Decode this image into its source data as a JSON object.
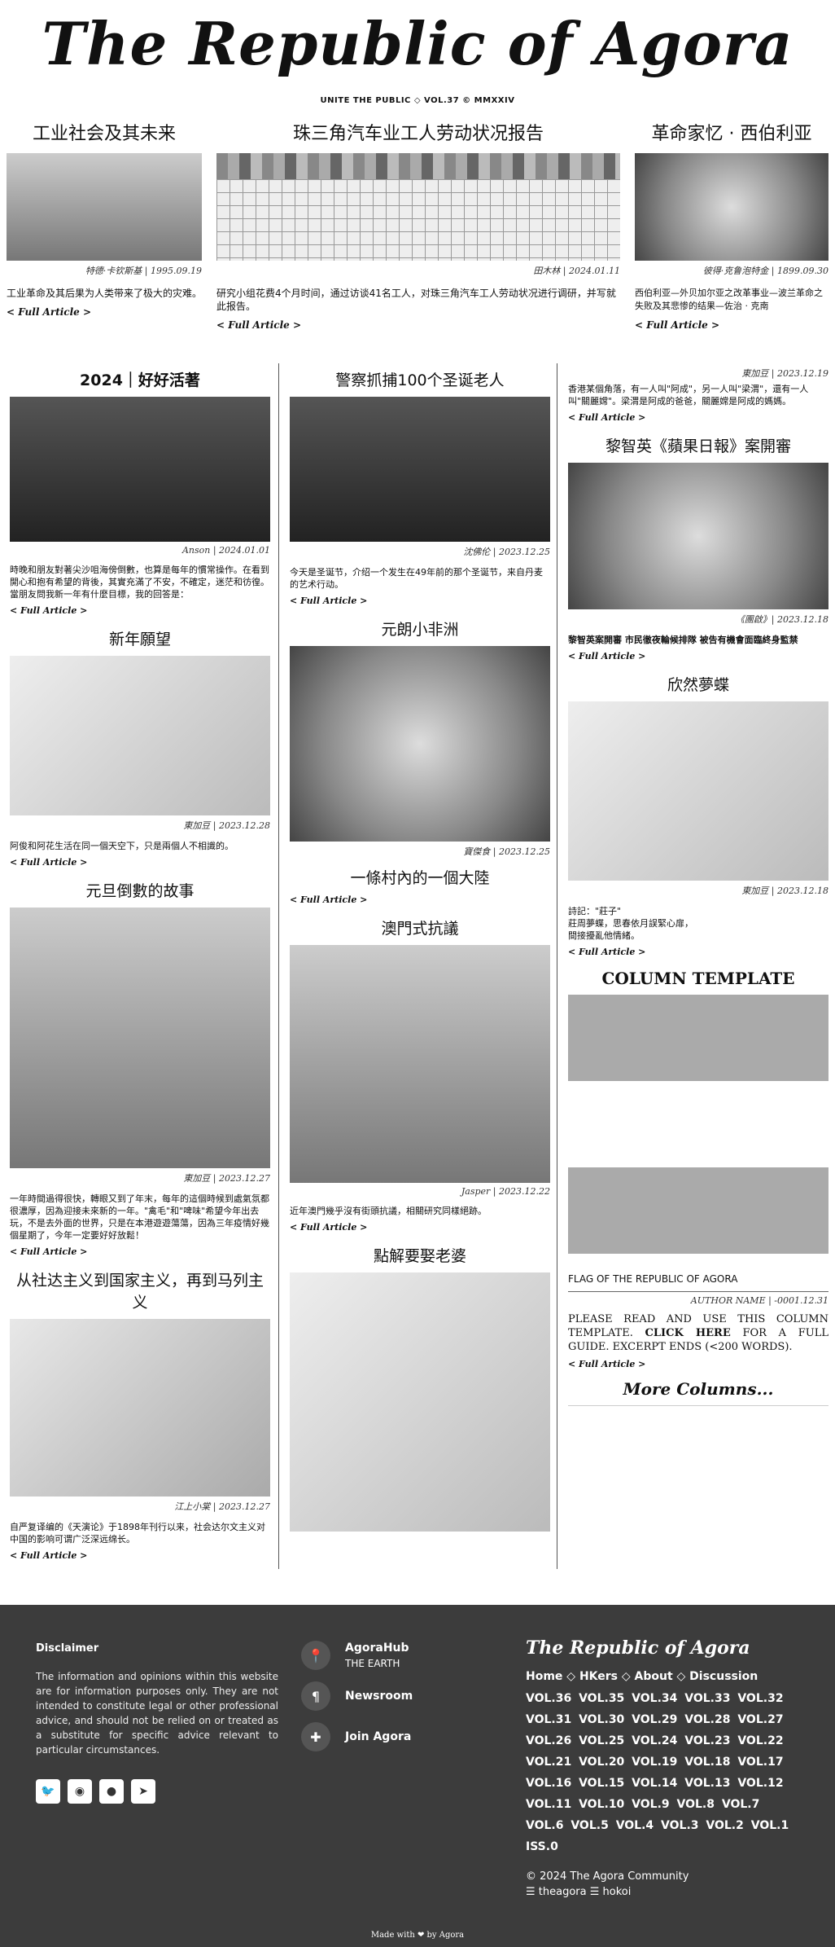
{
  "masthead": {
    "title": "The Republic of Agora",
    "subtitle": "UNITE THE PUBLIC ◇ VOL.37 © MMXXIV"
  },
  "top": [
    {
      "title": "工业社会及其未来",
      "byline": "特德·卡钦斯基 | 1995.09.19",
      "excerpt": "工业革命及其后果为人类带来了极大的灾难。",
      "more": "< Full Article >"
    },
    {
      "title": "珠三角汽车业工人劳动状况报告",
      "byline": "田木林 | 2024.01.11",
      "excerpt": "研究小组花费4个月时间，通过访谈41名工人，对珠三角汽车工人劳动状况进行调研，并写就此报告。",
      "more": "< Full Article >"
    },
    {
      "title": "革命家忆 · 西伯利亚",
      "byline": "彼得·克鲁泡特金 | 1899.09.30",
      "excerpt": "西伯利亚—外贝加尔亚之改革事业—波兰革命之失败及其悲惨的结果—佐治 · 克南",
      "more": "< Full Article >"
    }
  ],
  "col1": [
    {
      "title": "2024｜好好活著",
      "byline": "Anson | 2024.01.01",
      "excerpt": "時晚和朋友對著尖沙咀海傍倒數，也算是每年的慣常操作。在看到開心和抱有希望的背後，其實充滿了不安，不確定，迷茫和彷徨。當朋友問我新一年有什麼目標，我的回答是：",
      "more": "< Full Article >"
    },
    {
      "title": "新年願望",
      "byline": "東加豆 | 2023.12.28",
      "excerpt": "阿俊和阿花生活在同一個天空下，只是兩個人不相識的。",
      "more": "< Full Article >"
    },
    {
      "title": "元旦倒數的故事",
      "byline": "東加豆 | 2023.12.27",
      "excerpt": "一年時間過得很快，轉眼又到了年末，每年的這個時候到處氣氛都很濃厚，因為迎接未來新的一年。\"禽毛\"和\"啤味\"希望今年出去玩，不是去外面的世界，只是在本港遊遊蕩蕩，因為三年疫情好幾個星期了，今年一定要好好放鬆！",
      "more": "< Full Article >"
    },
    {
      "title": "从社达主义到国家主义，再到马列主义",
      "byline": "江上小棠 | 2023.12.27",
      "excerpt": "自严复译编的《天演论》于1898年刊行以来，社会达尔文主义对中国的影响可谓广泛深远绵长。",
      "more": "< Full Article >"
    }
  ],
  "col2": [
    {
      "title": "警察抓捕100个圣诞老人",
      "byline": "沈佛伦 | 2023.12.25",
      "excerpt": "今天是圣诞节，介绍一个发生在49年前的那个圣诞节，来自丹麦的艺术行动。",
      "more": "< Full Article >"
    },
    {
      "title": "元朗小非洲",
      "byline": "寶傑食 | 2023.12.25",
      "subtitle": "一條村內的一個大陸",
      "more": "< Full Article >"
    },
    {
      "title": "澳門式抗議",
      "byline": "Jasper | 2023.12.22",
      "excerpt": "近年澳門幾乎沒有街頭抗議，相關研究同樣絕跡。",
      "more": "< Full Article >"
    },
    {
      "title": "點解要娶老婆"
    }
  ],
  "col3": [
    {
      "byline": "東加豆 | 2023.12.19",
      "excerpt": "香港某個角落，有一人叫\"阿成\"，另一人叫\"梁渭\"，還有一人叫\"關麗嫦\"。梁渭是阿成的爸爸，關麗嫦是阿成的媽媽。",
      "more": "< Full Article >"
    },
    {
      "title": "黎智英《蘋果日報》案開審",
      "byline": "《團啟》| 2023.12.18",
      "excerpt": "黎智英案開審 市民徹夜輪候排隊 被告有機會面臨終身監禁",
      "more": "< Full Article >"
    },
    {
      "title": "欣然夢蝶",
      "byline": "東加豆 | 2023.12.18",
      "excerpt": "詩記：\"莊子\"\n莊周夢蝶，思春依月誤緊心扉，\n間接擾亂他情緒。",
      "more": "< Full Article >"
    }
  ],
  "template": {
    "title": "COLUMN TEMPLATE",
    "flag": "FLAG OF THE REPUBLIC OF AGORA",
    "byline": "AUTHOR NAME | -0001.12.31",
    "text_a": "PLEASE READ AND USE THIS COLUMN TEMPLATE. ",
    "text_b": "CLICK HERE",
    "text_c": " FOR A FULL GUIDE. EXCERPT ENDS (<200 WORDS).",
    "more": "< Full Article >",
    "more_cols": "More Columns..."
  },
  "footer": {
    "disc_title": "Disclaimer",
    "disc_text": "The information and opinions within this website are for information purposes only. They are not intended to constitute legal or other professional advice, and should not be relied on or treated as a substitute for specific advice relevant to particular circumstances.",
    "links": [
      {
        "title": "AgoraHub",
        "sub": "THE EARTH",
        "icon": "location-icon"
      },
      {
        "title": "Newsroom",
        "sub": "",
        "icon": "paragraph-icon"
      },
      {
        "title": "Join Agora",
        "sub": "",
        "icon": "puzzle-icon"
      }
    ],
    "ftitle": "The Republic of Agora",
    "nav": [
      "Home",
      "HKers",
      "About",
      "Discussion"
    ],
    "vols": "VOL.36 VOL.35 VOL.34 VOL.33 VOL.32 VOL.31 VOL.30 VOL.29 VOL.28 VOL.27 VOL.26 VOL.25 VOL.24 VOL.23 VOL.22 VOL.21 VOL.20 VOL.19 VOL.18 VOL.17 VOL.16 VOL.15 VOL.14 VOL.13 VOL.12 VOL.11 VOL.10 VOL.9 VOL.8 VOL.7 VOL.6 VOL.5 VOL.4 VOL.3 VOL.2 VOL.1 ISS.0",
    "copyright": "© 2024 The Agora Community",
    "credit": "☰ theagora ☰ hokoi",
    "made_with": "Made with ❤ by Agora"
  }
}
